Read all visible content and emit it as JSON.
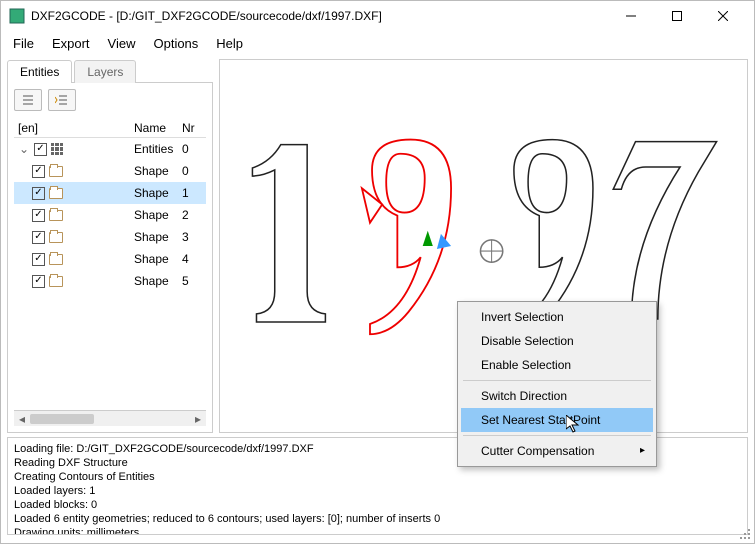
{
  "title": "DXF2GCODE - [D:/GIT_DXF2GCODE/sourcecode/dxf/1997.DXF]",
  "menus": {
    "file": "File",
    "export": "Export",
    "view": "View",
    "options": "Options",
    "help": "Help"
  },
  "tabs": {
    "entities": "Entities",
    "layers": "Layers"
  },
  "tree_headers": {
    "tree": "[en]",
    "name": "Name",
    "nr": "Nr"
  },
  "tree": {
    "root": {
      "name": "Entities",
      "nr": "0"
    },
    "shapes": [
      {
        "name": "Shape",
        "nr": "0"
      },
      {
        "name": "Shape",
        "nr": "1"
      },
      {
        "name": "Shape",
        "nr": "2"
      },
      {
        "name": "Shape",
        "nr": "3"
      },
      {
        "name": "Shape",
        "nr": "4"
      },
      {
        "name": "Shape",
        "nr": "5"
      }
    ]
  },
  "context_menu": {
    "invert": "Invert Selection",
    "disable": "Disable Selection",
    "enable": "Enable Selection",
    "switch": "Switch Direction",
    "startpoint": "Set Nearest StartPoint",
    "cutter": "Cutter Compensation"
  },
  "status": {
    "l1": "Loading file: D:/GIT_DXF2GCODE/sourcecode/dxf/1997.DXF",
    "l2": "Reading DXF Structure",
    "l3": "Creating Contours of Entities",
    "l4": "Loaded layers: 1",
    "l5": "Loaded blocks: 0",
    "l6": "Loaded 6 entity geometries; reduced to 6 contours; used layers: [0]; number of inserts 0",
    "l7": "Drawing units: millimeters"
  }
}
